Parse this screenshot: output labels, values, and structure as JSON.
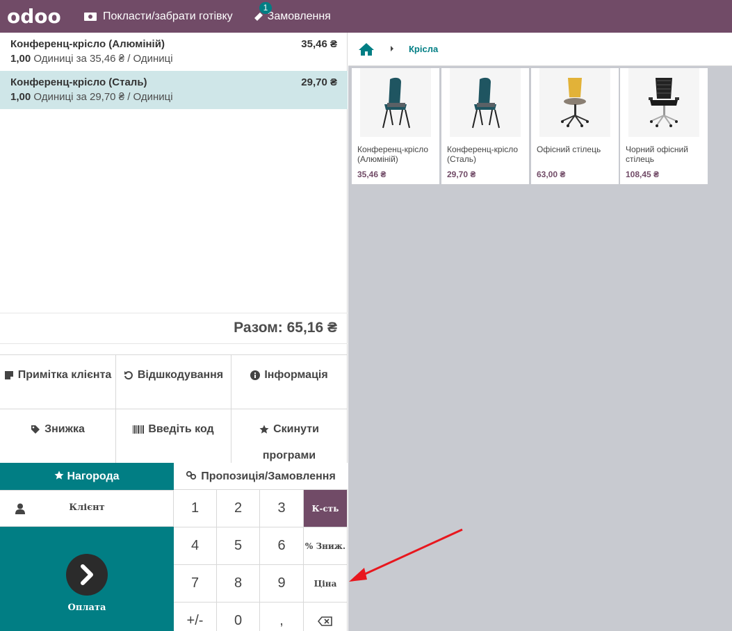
{
  "topbar": {
    "logo_text": "odoo",
    "cash_label": "Покласти/забрати готівку",
    "orders_label": "Замовлення",
    "orders_badge": "1"
  },
  "order": {
    "lines": [
      {
        "name": "Конференц-крісло (Алюміній)",
        "price": "35,46 ₴",
        "qty": "1,00",
        "unit_info": "Одиниці за 35,46 ₴ / Одиниці",
        "selected": false
      },
      {
        "name": "Конференц-крісло (Сталь)",
        "price": "29,70 ₴",
        "qty": "1,00",
        "unit_info": "Одиниці за 29,70 ₴ / Одиниці",
        "selected": true
      }
    ],
    "total": "Разом: 65,16 ₴"
  },
  "controls": {
    "customer_note": "Примітка клієнта",
    "refund": "Відшкодування",
    "info": "Інформація",
    "discount": "Знижка",
    "enter_code": "Введіть код",
    "reset_programs": "Скинути програми",
    "reward": "Нагорода",
    "proposal": "Пропозиція/Замовлення",
    "client": "Клієнт",
    "payment": "Оплата"
  },
  "numpad": {
    "keys": [
      "1",
      "2",
      "3",
      "К-сть",
      "4",
      "5",
      "6",
      "% Зниж.",
      "7",
      "8",
      "9",
      "Ціна",
      "+/-",
      "0",
      ","
    ],
    "active_mode": "К-сть"
  },
  "breadcrumb": {
    "category": "Крісла"
  },
  "products": [
    {
      "name": "Конференц-крісло (Алюміній)",
      "price": "35,46 ₴",
      "image": "teal-chair"
    },
    {
      "name": "Конференц-крісло (Сталь)",
      "price": "29,70 ₴",
      "image": "teal-chair"
    },
    {
      "name": "Офісний стілець",
      "price": "63,00 ₴",
      "image": "yellow-office-chair"
    },
    {
      "name": "Чорний офісний стілець",
      "price": "108,45 ₴",
      "image": "black-office-chair"
    }
  ],
  "colors": {
    "brand": "#714b67",
    "accent": "#017e84",
    "selected_line": "#cfe6e8",
    "annotation_arrow": "#e8171e"
  }
}
